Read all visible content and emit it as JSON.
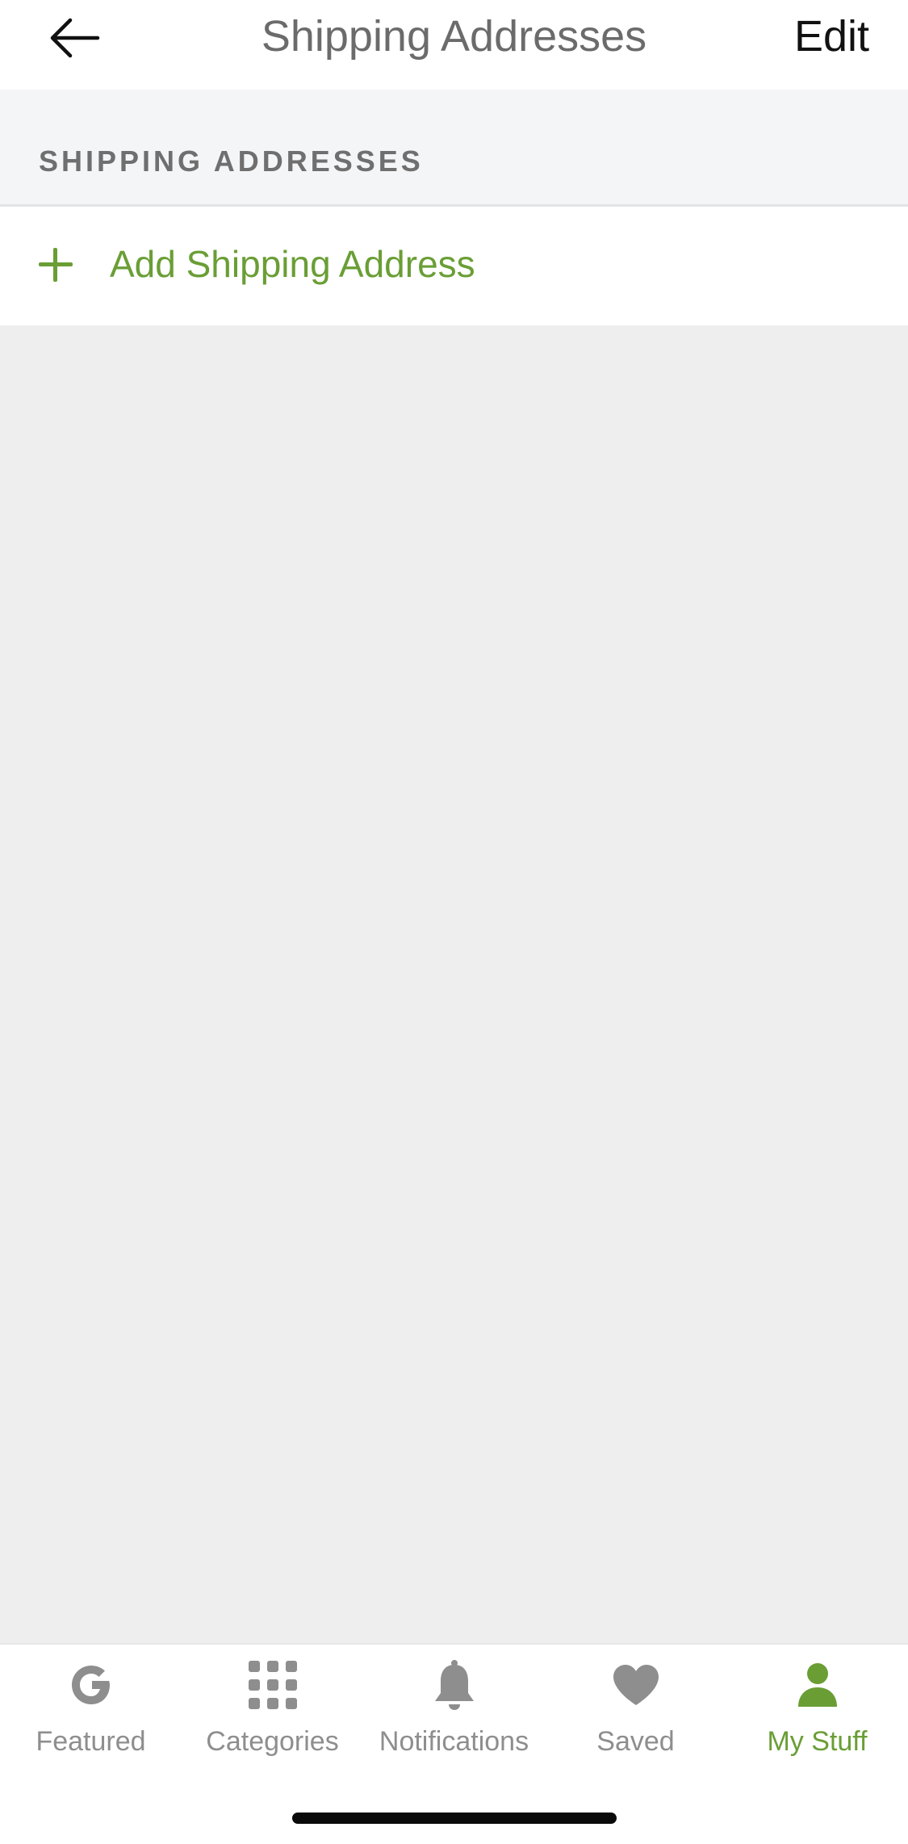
{
  "navbar": {
    "title": "Shipping Addresses",
    "edit_label": "Edit",
    "back_icon": "arrow-left-icon"
  },
  "section": {
    "header_label": "SHIPPING ADDRESSES",
    "add_label": "Add Shipping Address",
    "add_icon": "plus-icon"
  },
  "tabbar": {
    "tabs": [
      {
        "label": "Featured",
        "icon": "g-logo-icon",
        "active": false
      },
      {
        "label": "Categories",
        "icon": "grid-icon",
        "active": false
      },
      {
        "label": "Notifications",
        "icon": "bell-icon",
        "active": false
      },
      {
        "label": "Saved",
        "icon": "heart-icon",
        "active": false
      },
      {
        "label": "My Stuff",
        "icon": "person-icon",
        "active": true
      }
    ]
  },
  "colors": {
    "accent": "#6a9e35",
    "inactive": "#8e8e8e",
    "background": "#eeeeee",
    "section_header_bg": "#f4f5f7"
  }
}
